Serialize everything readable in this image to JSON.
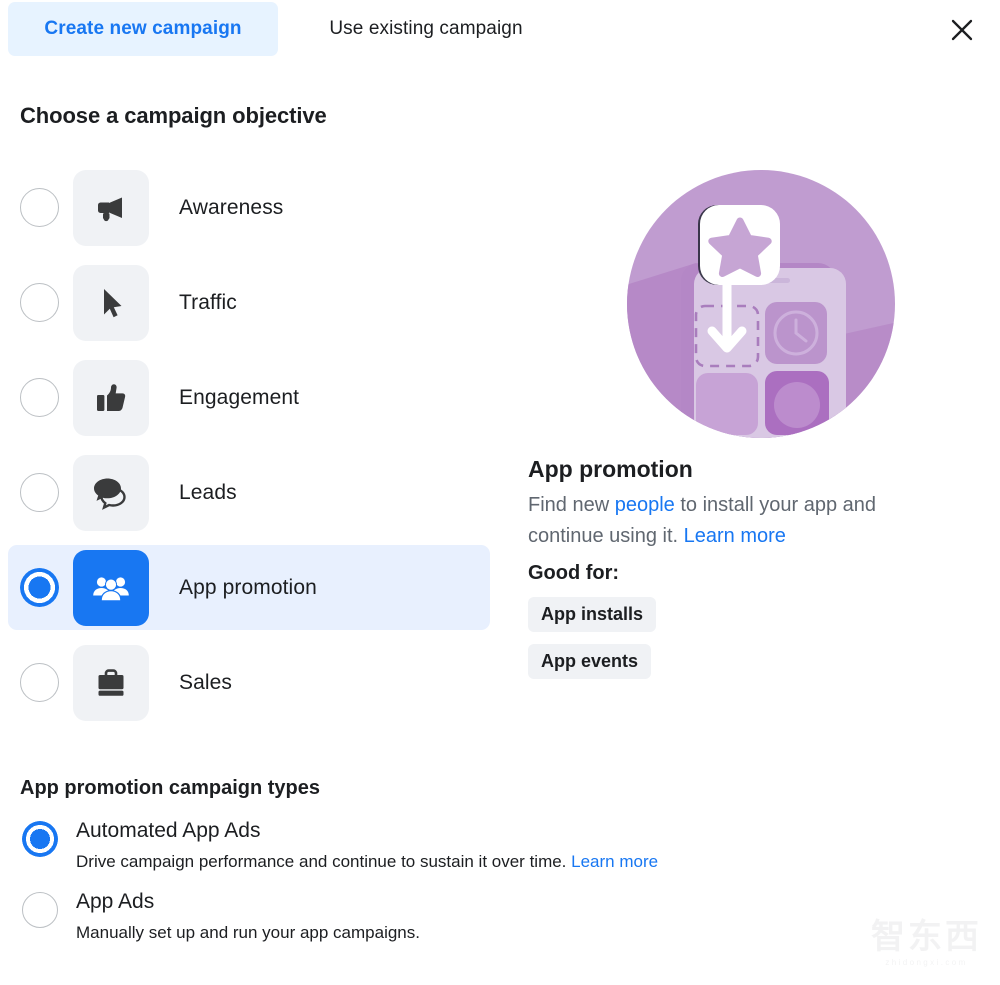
{
  "tabs": [
    {
      "label": "Create new campaign",
      "active": true
    },
    {
      "label": "Use existing campaign",
      "active": false
    }
  ],
  "close_icon": "close-icon",
  "objective_section": {
    "heading": "Choose a campaign objective",
    "options": [
      {
        "label": "Awareness",
        "icon": "megaphone-icon",
        "selected": false
      },
      {
        "label": "Traffic",
        "icon": "cursor-icon",
        "selected": false
      },
      {
        "label": "Engagement",
        "icon": "thumbs-up-icon",
        "selected": false
      },
      {
        "label": "Leads",
        "icon": "chat-bubbles-icon",
        "selected": false
      },
      {
        "label": "App promotion",
        "icon": "people-group-icon",
        "selected": true
      },
      {
        "label": "Sales",
        "icon": "briefcase-icon",
        "selected": false
      }
    ]
  },
  "info_panel": {
    "illustration": "app-promotion-illustration",
    "title": "App promotion",
    "description_part1": "Find new ",
    "description_link1": "people",
    "description_part2": " to install your app and continue using it. ",
    "description_link2": "Learn more",
    "good_for_label": "Good for:",
    "tags": [
      "App installs",
      "App events"
    ]
  },
  "campaign_types": {
    "heading": "App promotion campaign types",
    "options": [
      {
        "title": "Automated App Ads",
        "subtitle": "Drive campaign performance and continue to sustain it over time. ",
        "link": "Learn more",
        "selected": true
      },
      {
        "title": "App Ads",
        "subtitle": "Manually set up and run your app campaigns.",
        "link": "",
        "selected": false
      }
    ]
  },
  "watermark": {
    "cn": "智东西",
    "en": "zhidongxi.com"
  },
  "colors": {
    "accent": "#1877f2",
    "tab_active_bg": "#e7f3ff",
    "row_selected_bg": "#e8f0fe",
    "tile_bg": "#f0f2f5",
    "text_primary": "#1c1e21",
    "text_secondary": "#606770",
    "illustration_purple": "#b98cc4"
  }
}
